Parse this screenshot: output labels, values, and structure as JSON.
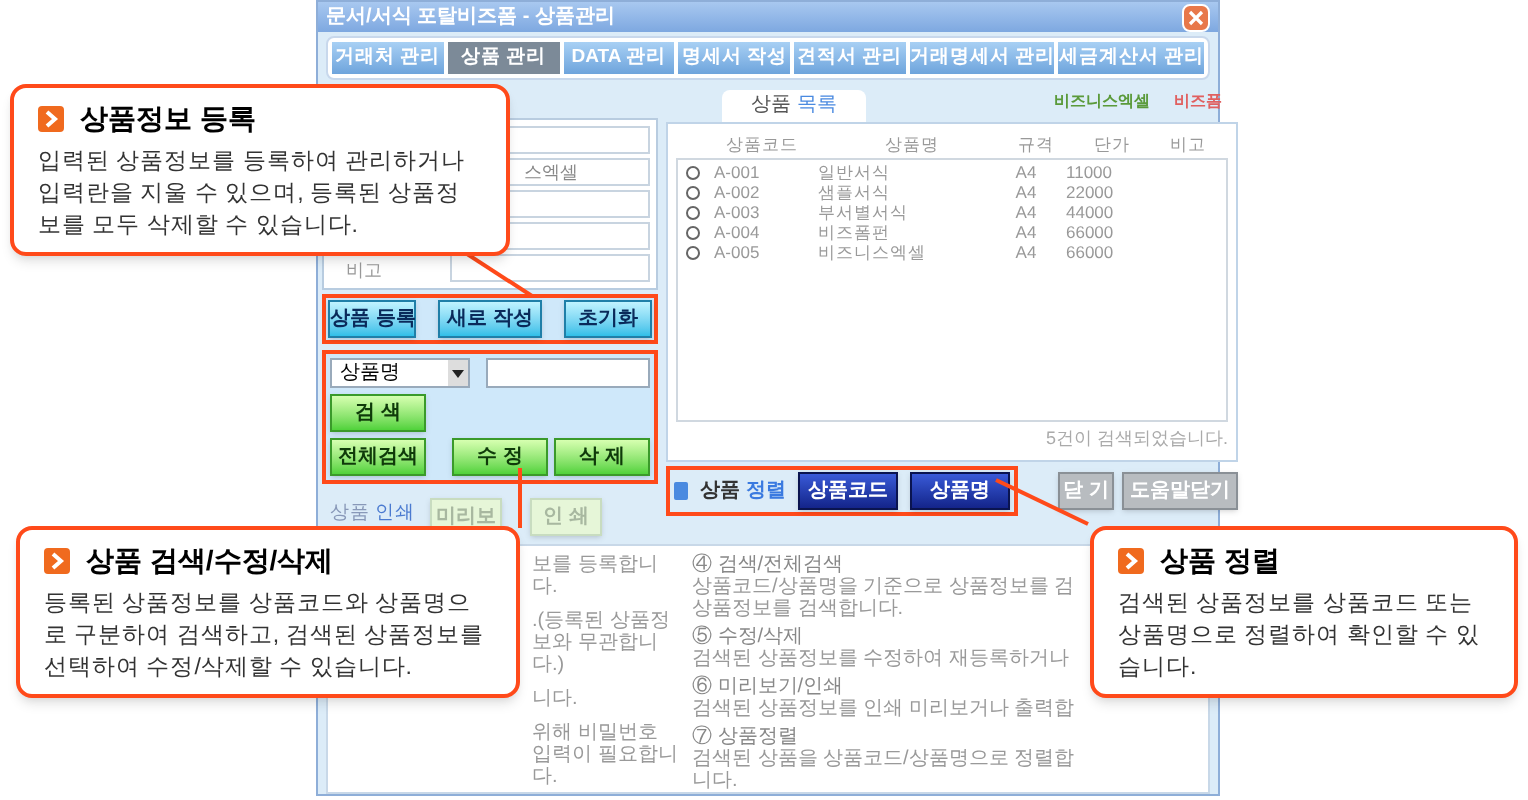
{
  "window": {
    "title": "문서/서식 포탈비즈폼 - 상품관리"
  },
  "tabs": [
    {
      "label": "거래처 관리",
      "selected": false
    },
    {
      "label": "상품 관리",
      "selected": true
    },
    {
      "label": "DATA 관리",
      "selected": false
    },
    {
      "label": "명세서 작성",
      "selected": false
    },
    {
      "label": "견적서 관리",
      "selected": false
    },
    {
      "label": "거래명세서 관리",
      "selected": false
    },
    {
      "label": "세금계산서 관리",
      "selected": false
    }
  ],
  "form": {
    "fields": [
      {
        "kind": "text"
      },
      {
        "kind": "text",
        "value": "스엑셀"
      },
      {
        "kind": "text"
      },
      {
        "kind": "text"
      },
      {
        "kind": "text",
        "label": "비고"
      }
    ],
    "buttons": [
      "상품 등록",
      "새로 작성",
      "초기화"
    ]
  },
  "search": {
    "field_select": "상품명",
    "buttons": [
      "검 색",
      "전체검색",
      "수 정",
      "삭 제"
    ]
  },
  "print": {
    "label": "상품 인쇄",
    "buttons": [
      {
        "label": "미리보",
        "disabled": true
      },
      {
        "label": "인 쇄",
        "disabled": true
      }
    ]
  },
  "product_list": {
    "tab": "상품 목록",
    "logos": [
      "비즈니스엑셀",
      "비즈폼"
    ],
    "columns": [
      "상품코드",
      "상품명",
      "규격",
      "단가",
      "비고"
    ],
    "rows": [
      {
        "code": "A-001",
        "name": "일반서식",
        "spec": "A4",
        "price": "11000",
        "selected": false
      },
      {
        "code": "A-002",
        "name": "샘플서식",
        "spec": "A4",
        "price": "22000",
        "selected": false
      },
      {
        "code": "A-003",
        "name": "부서별서식",
        "spec": "A4",
        "price": "44000",
        "selected": false
      },
      {
        "code": "A-004",
        "name": "비즈폼펀",
        "spec": "A4",
        "price": "66000",
        "selected": false
      },
      {
        "code": "A-005",
        "name": "비즈니스엑셀",
        "spec": "A4",
        "price": "66000",
        "selected": false
      }
    ],
    "status": "5건이 검색되었습니다."
  },
  "sort": {
    "label": "상품 정렬",
    "buttons": [
      "상품코드",
      "상품명"
    ]
  },
  "window_buttons": [
    "닫 기",
    "도움말닫기"
  ],
  "help": {
    "left": [
      "보를 등록합니다.",
      ".(등록된 상품정보와 무관합니다.)",
      "니다.",
      "위해 비밀번호 입력이 필요합니다."
    ],
    "right": [
      {
        "heading": "④ 검색/전체검색",
        "lines": [
          "상품코드/상품명을 기준으로 상품정보를 검",
          "상품정보를 검색합니다."
        ]
      },
      {
        "heading": "⑤ 수정/삭제",
        "lines": [
          "검색된 상품정보를 수정하여 재등록하거나"
        ]
      },
      {
        "heading": "⑥ 미리보기/인쇄",
        "lines": [
          "검색된 상품정보를 인쇄 미리보거나 출력합"
        ]
      },
      {
        "heading": "⑦ 상품정렬",
        "lines": [
          "검색된 상품을 상품코드/상품명으로 정렬합니다."
        ]
      }
    ]
  },
  "callouts": [
    {
      "title": "상품정보 등록",
      "text": "입력된 상품정보를 등록하여 관리하거나 입력란을 지울 수 있으며, 등록된 상품정보를 모두 삭제할 수 있습니다."
    },
    {
      "title": "상품 검색/수정/삭제",
      "text": "등록된 상품정보를 상품코드와 상품명으로 구분하여 검색하고, 검색된 상품정보를 선택하여 수정/삭제할 수 있습니다."
    },
    {
      "title": "상품 정렬",
      "text": "검색된 상품정보를 상품코드 또는 상품명으로 정렬하여 확인할 수 있습니다."
    }
  ]
}
